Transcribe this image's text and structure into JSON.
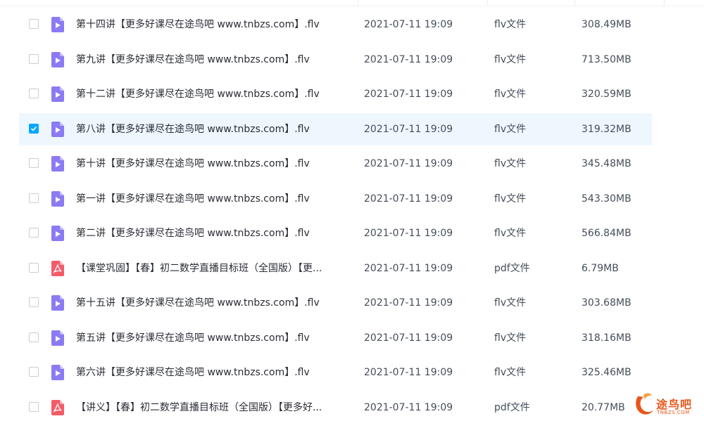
{
  "files": [
    {
      "name": "第十四讲【更多好课尽在途鸟吧 www.tnbzs.com】.flv",
      "date": "2021-07-11 19:09",
      "type": "flv文件",
      "size": "308.49MB",
      "icon": "video-file-icon",
      "selected": false
    },
    {
      "name": "第九讲【更多好课尽在途鸟吧 www.tnbzs.com】.flv",
      "date": "2021-07-11 19:09",
      "type": "flv文件",
      "size": "713.50MB",
      "icon": "video-file-icon",
      "selected": false
    },
    {
      "name": "第十二讲【更多好课尽在途鸟吧 www.tnbzs.com】.flv",
      "date": "2021-07-11 19:09",
      "type": "flv文件",
      "size": "320.59MB",
      "icon": "video-file-icon",
      "selected": false
    },
    {
      "name": "第八讲【更多好课尽在途鸟吧 www.tnbzs.com】.flv",
      "date": "2021-07-11 19:09",
      "type": "flv文件",
      "size": "319.32MB",
      "icon": "video-file-icon",
      "selected": true
    },
    {
      "name": "第十讲【更多好课尽在途鸟吧 www.tnbzs.com】.flv",
      "date": "2021-07-11 19:09",
      "type": "flv文件",
      "size": "345.48MB",
      "icon": "video-file-icon",
      "selected": false
    },
    {
      "name": "第一讲【更多好课尽在途鸟吧 www.tnbzs.com】.flv",
      "date": "2021-07-11 19:09",
      "type": "flv文件",
      "size": "543.30MB",
      "icon": "video-file-icon",
      "selected": false
    },
    {
      "name": "第二讲【更多好课尽在途鸟吧 www.tnbzs.com】.flv",
      "date": "2021-07-11 19:09",
      "type": "flv文件",
      "size": "566.84MB",
      "icon": "video-file-icon",
      "selected": false
    },
    {
      "name": "【课堂巩固】【春】初二数学直播目标班（全国版）【更...",
      "date": "2021-07-11 19:09",
      "type": "pdf文件",
      "size": "6.79MB",
      "icon": "pdf-file-icon",
      "selected": false
    },
    {
      "name": "第十五讲【更多好课尽在途鸟吧 www.tnbzs.com】.flv",
      "date": "2021-07-11 19:09",
      "type": "flv文件",
      "size": "303.68MB",
      "icon": "video-file-icon",
      "selected": false
    },
    {
      "name": "第五讲【更多好课尽在途鸟吧 www.tnbzs.com】.flv",
      "date": "2021-07-11 19:09",
      "type": "flv文件",
      "size": "318.16MB",
      "icon": "video-file-icon",
      "selected": false
    },
    {
      "name": "第六讲【更多好课尽在途鸟吧 www.tnbzs.com】.flv",
      "date": "2021-07-11 19:09",
      "type": "flv文件",
      "size": "325.46MB",
      "icon": "video-file-icon",
      "selected": false
    },
    {
      "name": "【讲义】【春】初二数学直播目标班（全国版）【更多好...",
      "date": "2021-07-11 19:09",
      "type": "pdf文件",
      "size": "20.77MB",
      "icon": "pdf-file-icon",
      "selected": false
    }
  ],
  "watermark": {
    "text": "途鸟吧",
    "sub": "TNBZS.COM",
    "color": "#e8561b"
  },
  "colors": {
    "video_icon": "#8b7bf3",
    "pdf_icon": "#f45b69",
    "accent": "#06a7ff",
    "selected_row": "#eef7fe"
  }
}
